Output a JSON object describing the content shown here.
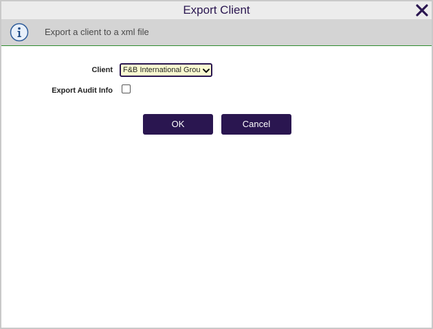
{
  "dialog": {
    "title": "Export Client",
    "close_icon": "close-icon"
  },
  "info": {
    "icon": "info-icon",
    "message": "Export a client to a xml file"
  },
  "form": {
    "client_label": "Client",
    "client_value": "F&B International Group",
    "audit_label": "Export Audit Info",
    "audit_checked": false
  },
  "buttons": {
    "ok_label": "OK",
    "cancel_label": "Cancel"
  },
  "colors": {
    "primary": "#2a1650",
    "info_bar": "#d4d4d4",
    "info_border": "#2d8a2d",
    "select_bg": "#fbfbd2"
  }
}
